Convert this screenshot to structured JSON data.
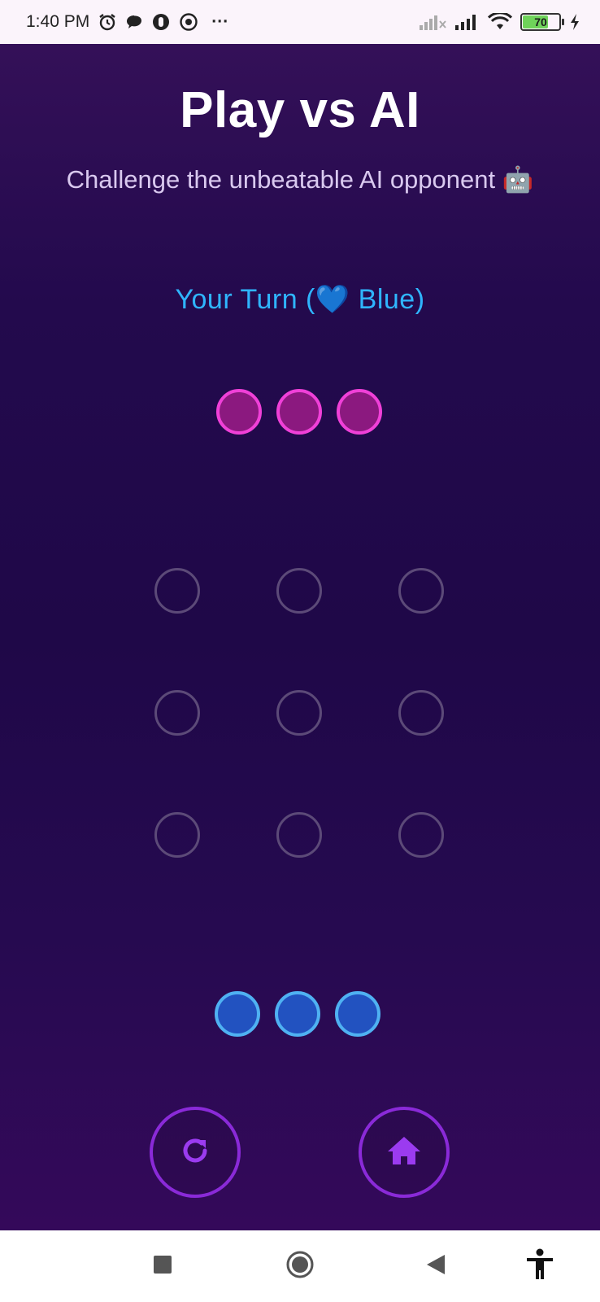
{
  "status_bar": {
    "time": "1:40 PM",
    "more": "···",
    "battery_level": "70",
    "battery_fraction": 0.7,
    "icons": [
      "alarm-icon",
      "chat-icon",
      "app-icon",
      "sync-icon",
      "signal-icon",
      "signal-icon",
      "wifi-icon",
      "battery-icon",
      "charging-icon"
    ]
  },
  "app": {
    "title": "Play vs AI",
    "subtitle": "Challenge the unbeatable AI opponent 🤖",
    "turn_text": "Your Turn (💙 Blue)",
    "colors": {
      "turn_text": "#2fb5ff",
      "ai_piece": "#f040d8",
      "player_piece": "#4fb1f2",
      "button_ring": "#8a2ad8"
    },
    "ai_pieces": 3,
    "player_pieces": 3,
    "board": [
      [
        "empty",
        "empty",
        "empty"
      ],
      [
        "empty",
        "empty",
        "empty"
      ],
      [
        "empty",
        "empty",
        "empty"
      ]
    ],
    "buttons": {
      "restart_icon": "restart-icon",
      "home_icon": "home-icon"
    }
  },
  "nav_bar": {
    "icons": [
      "recents-icon",
      "home-circle-icon",
      "back-icon",
      "accessibility-icon"
    ]
  }
}
